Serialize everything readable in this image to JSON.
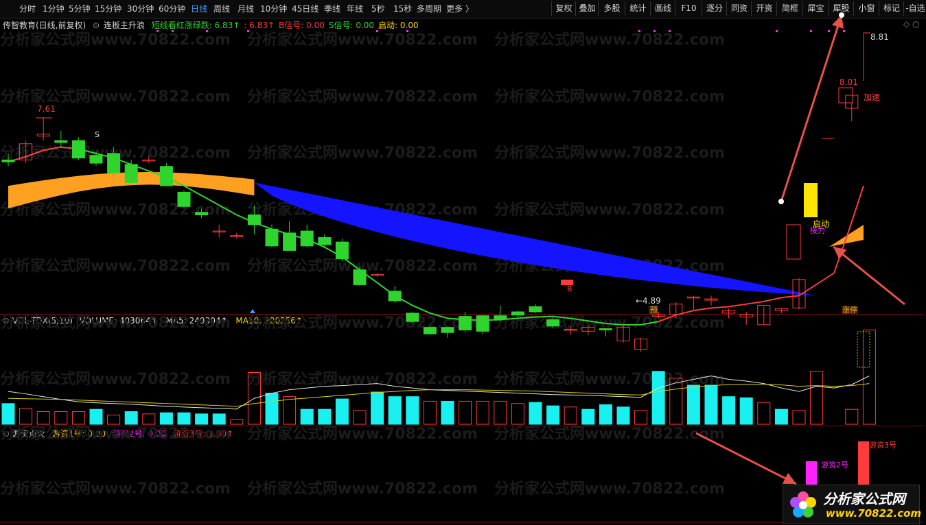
{
  "toolbar": {
    "periods": [
      "分时",
      "1分钟",
      "5分钟",
      "15分钟",
      "30分钟",
      "60分钟",
      "日线",
      "周线",
      "月线",
      "10分钟",
      "45日线",
      "季线",
      "年线",
      "5秒",
      "15秒",
      "多周期",
      "更多 〉"
    ],
    "active_period": "日线",
    "tools": [
      "复权",
      "叠加",
      "多股",
      "统计",
      "画线",
      "F10",
      "逐分",
      "同资",
      "开资",
      "简框",
      "犀宝",
      "犀股",
      "小窗",
      "标记",
      "-自选"
    ]
  },
  "main_panel": {
    "stock_name": "传智教育(日线,前复权)",
    "indicator_name": "连板主升浪",
    "fields": [
      {
        "label": "短线看红涨绿跌:",
        "value": "6.83↑",
        "color": "#2fd52f"
      },
      {
        "label": ":",
        "value": "6.83↑",
        "color": "#ff3b3b"
      },
      {
        "label": "B信号:",
        "value": "0.00",
        "color": "#ff3b3b"
      },
      {
        "label": "S信号:",
        "value": "0.00",
        "color": "#2fd52f"
      },
      {
        "label": "启动:",
        "value": "0.00",
        "color": "#ffd400"
      }
    ],
    "price_labels": {
      "high_left": "7.61",
      "low": "←4.89",
      "high_right": "8.81",
      "mid_right": "8.01"
    },
    "annotations": {
      "accelerate": "加速",
      "start": "启动",
      "take": "接力",
      "pre": "预",
      "limit_up": "涨停",
      "s_mark": "S",
      "b_mark": "B"
    }
  },
  "volume_panel": {
    "name": "VOL-TDX(5,10)",
    "volume_label": "VOLUME:",
    "volume_value": "403064↑",
    "ma5_label": "MA5:",
    "ma5_value": "249304↑",
    "ma10_label": "MA10:",
    "ma10_value": "200256↑"
  },
  "capital_panel": {
    "name": "游资点火",
    "f1_label": "游资1号:",
    "f1_value": "0.00",
    "f2_label": "游资2号:",
    "f2_value": "0.00",
    "f3_label": "游资3号:",
    "f3_value": "1.00↑",
    "bar2_label": "游资2号",
    "bar3_label": "游资3号"
  },
  "watermark": "分析家公式网www.70822.com",
  "logo": {
    "title": "分析家公式网",
    "url": "www.70822.com"
  },
  "colors": {
    "up": "#ff3b3b",
    "down": "#2fd52f",
    "blue_band": "#1414ff",
    "orange_band": "#ffa020",
    "cyan": "#19f0f0",
    "magenta": "#ff22ff",
    "yellow": "#ffe600",
    "arrow": "#e8504a"
  },
  "chart_data": {
    "type": "candlestick",
    "price_range": [
      4.6,
      9.0
    ],
    "candles": [
      {
        "o": 6.95,
        "h": 7.05,
        "l": 6.85,
        "c": 6.92
      },
      {
        "o": 6.95,
        "h": 7.25,
        "l": 6.9,
        "c": 7.2
      },
      {
        "o": 7.32,
        "h": 7.61,
        "l": 7.25,
        "c": 7.35
      },
      {
        "o": 7.25,
        "h": 7.4,
        "l": 7.15,
        "c": 7.22
      },
      {
        "o": 7.25,
        "h": 7.3,
        "l": 6.95,
        "c": 6.98
      },
      {
        "o": 7.02,
        "h": 7.08,
        "l": 6.86,
        "c": 6.9
      },
      {
        "o": 7.05,
        "h": 7.15,
        "l": 6.7,
        "c": 6.75
      },
      {
        "o": 6.88,
        "h": 6.95,
        "l": 6.55,
        "c": 6.6
      },
      {
        "o": 6.95,
        "h": 7.02,
        "l": 6.9,
        "c": 6.95
      },
      {
        "o": 6.85,
        "h": 6.9,
        "l": 6.55,
        "c": 6.55
      },
      {
        "o": 6.45,
        "h": 6.48,
        "l": 6.2,
        "c": 6.23
      },
      {
        "o": 6.14,
        "h": 6.2,
        "l": 6.05,
        "c": 6.1
      },
      {
        "o": 5.85,
        "h": 5.95,
        "l": 5.75,
        "c": 5.85
      },
      {
        "o": 5.78,
        "h": 5.82,
        "l": 5.74,
        "c": 5.78
      },
      {
        "o": 6.1,
        "h": 6.25,
        "l": 5.8,
        "c": 5.95
      },
      {
        "o": 5.88,
        "h": 5.95,
        "l": 5.6,
        "c": 5.62
      },
      {
        "o": 5.82,
        "h": 6.0,
        "l": 5.55,
        "c": 5.55
      },
      {
        "o": 5.85,
        "h": 5.95,
        "l": 5.6,
        "c": 5.62
      },
      {
        "o": 5.75,
        "h": 5.8,
        "l": 5.6,
        "c": 5.64
      },
      {
        "o": 5.68,
        "h": 5.73,
        "l": 5.38,
        "c": 5.42
      },
      {
        "o": 5.25,
        "h": 5.3,
        "l": 5.0,
        "c": 5.02
      },
      {
        "o": 5.18,
        "h": 5.2,
        "l": 5.14,
        "c": 5.18
      },
      {
        "o": 4.92,
        "h": 5.0,
        "l": 4.74,
        "c": 4.77
      },
      {
        "o": 4.58,
        "h": 4.6,
        "l": 4.43,
        "c": 4.45
      },
      {
        "o": 4.36,
        "h": 4.38,
        "l": 4.24,
        "c": 4.26
      },
      {
        "o": 4.36,
        "h": 4.37,
        "l": 4.2,
        "c": 4.28
      },
      {
        "o": 4.53,
        "h": 4.6,
        "l": 4.28,
        "c": 4.32
      },
      {
        "o": 4.54,
        "h": 4.55,
        "l": 4.26,
        "c": 4.3
      },
      {
        "o": 4.54,
        "h": 4.7,
        "l": 4.46,
        "c": 4.49
      },
      {
        "o": 4.6,
        "h": 4.62,
        "l": 4.52,
        "c": 4.55
      },
      {
        "o": 4.68,
        "h": 4.72,
        "l": 4.58,
        "c": 4.6
      },
      {
        "o": 4.48,
        "h": 4.53,
        "l": 4.35,
        "c": 4.38
      },
      {
        "o": 4.32,
        "h": 4.38,
        "l": 4.25,
        "c": 4.33
      },
      {
        "o": 4.3,
        "h": 4.38,
        "l": 4.24,
        "c": 4.36
      },
      {
        "o": 4.34,
        "h": 4.35,
        "l": 4.22,
        "c": 4.32
      },
      {
        "o": 4.15,
        "h": 4.42,
        "l": 4.12,
        "c": 4.36
      },
      {
        "o": 4.02,
        "h": 4.2,
        "l": 3.98,
        "c": 4.18
      },
      {
        "o": 4.53,
        "h": 4.6,
        "l": 4.5,
        "c": 4.55
      },
      {
        "o": 4.56,
        "h": 4.75,
        "l": 4.5,
        "c": 4.72
      },
      {
        "o": 4.83,
        "h": 4.85,
        "l": 4.63,
        "c": 4.83
      },
      {
        "o": 4.78,
        "h": 4.85,
        "l": 4.7,
        "c": 4.8
      },
      {
        "o": 4.58,
        "h": 4.65,
        "l": 4.5,
        "c": 4.62
      },
      {
        "o": 4.52,
        "h": 4.6,
        "l": 4.4,
        "c": 4.56
      },
      {
        "o": 4.4,
        "h": 4.68,
        "l": 4.4,
        "c": 4.7
      },
      {
        "o": 4.62,
        "h": 4.65,
        "l": 4.58,
        "c": 4.65
      },
      {
        "o": 4.66,
        "h": 5.12,
        "l": 4.64,
        "c": 5.1
      },
      {
        "o": 4.66,
        "h": 4.66,
        "l": 4.66,
        "c": 4.66
      },
      {
        "o": 7.12,
        "h": 7.12,
        "l": 7.12,
        "c": 7.12
      },
      {
        "o": 7.75,
        "h": 7.84,
        "l": 7.55,
        "c": 7.95
      },
      {
        "o": 8.81,
        "h": 8.81,
        "l": 8.81,
        "c": 8.81
      }
    ],
    "volume_range": [
      0,
      420000
    ],
    "volumes": [
      90,
      70,
      55,
      55,
      55,
      65,
      40,
      55,
      45,
      50,
      50,
      45,
      45,
      20,
      225,
      135,
      120,
      65,
      65,
      110,
      60,
      140,
      120,
      120,
      100,
      100,
      100,
      100,
      100,
      90,
      95,
      80,
      75,
      65,
      85,
      75,
      60,
      230,
      200,
      170,
      170,
      120,
      115,
      95,
      65,
      60,
      230,
      0,
      65,
      410
    ],
    "volume_dir": [
      "d",
      "u",
      "u",
      "u",
      "u",
      "d",
      "u",
      "d",
      "u",
      "d",
      "d",
      "d",
      "d",
      "u",
      "u",
      "d",
      "u",
      "d",
      "d",
      "d",
      "u",
      "d",
      "d",
      "d",
      "u",
      "d",
      "u",
      "u",
      "u",
      "u",
      "d",
      "d",
      "u",
      "d",
      "d",
      "d",
      "u",
      "d",
      "u",
      "d",
      "d",
      "d",
      "d",
      "u",
      "d",
      "u",
      "u",
      "u",
      "u",
      "u"
    ]
  }
}
